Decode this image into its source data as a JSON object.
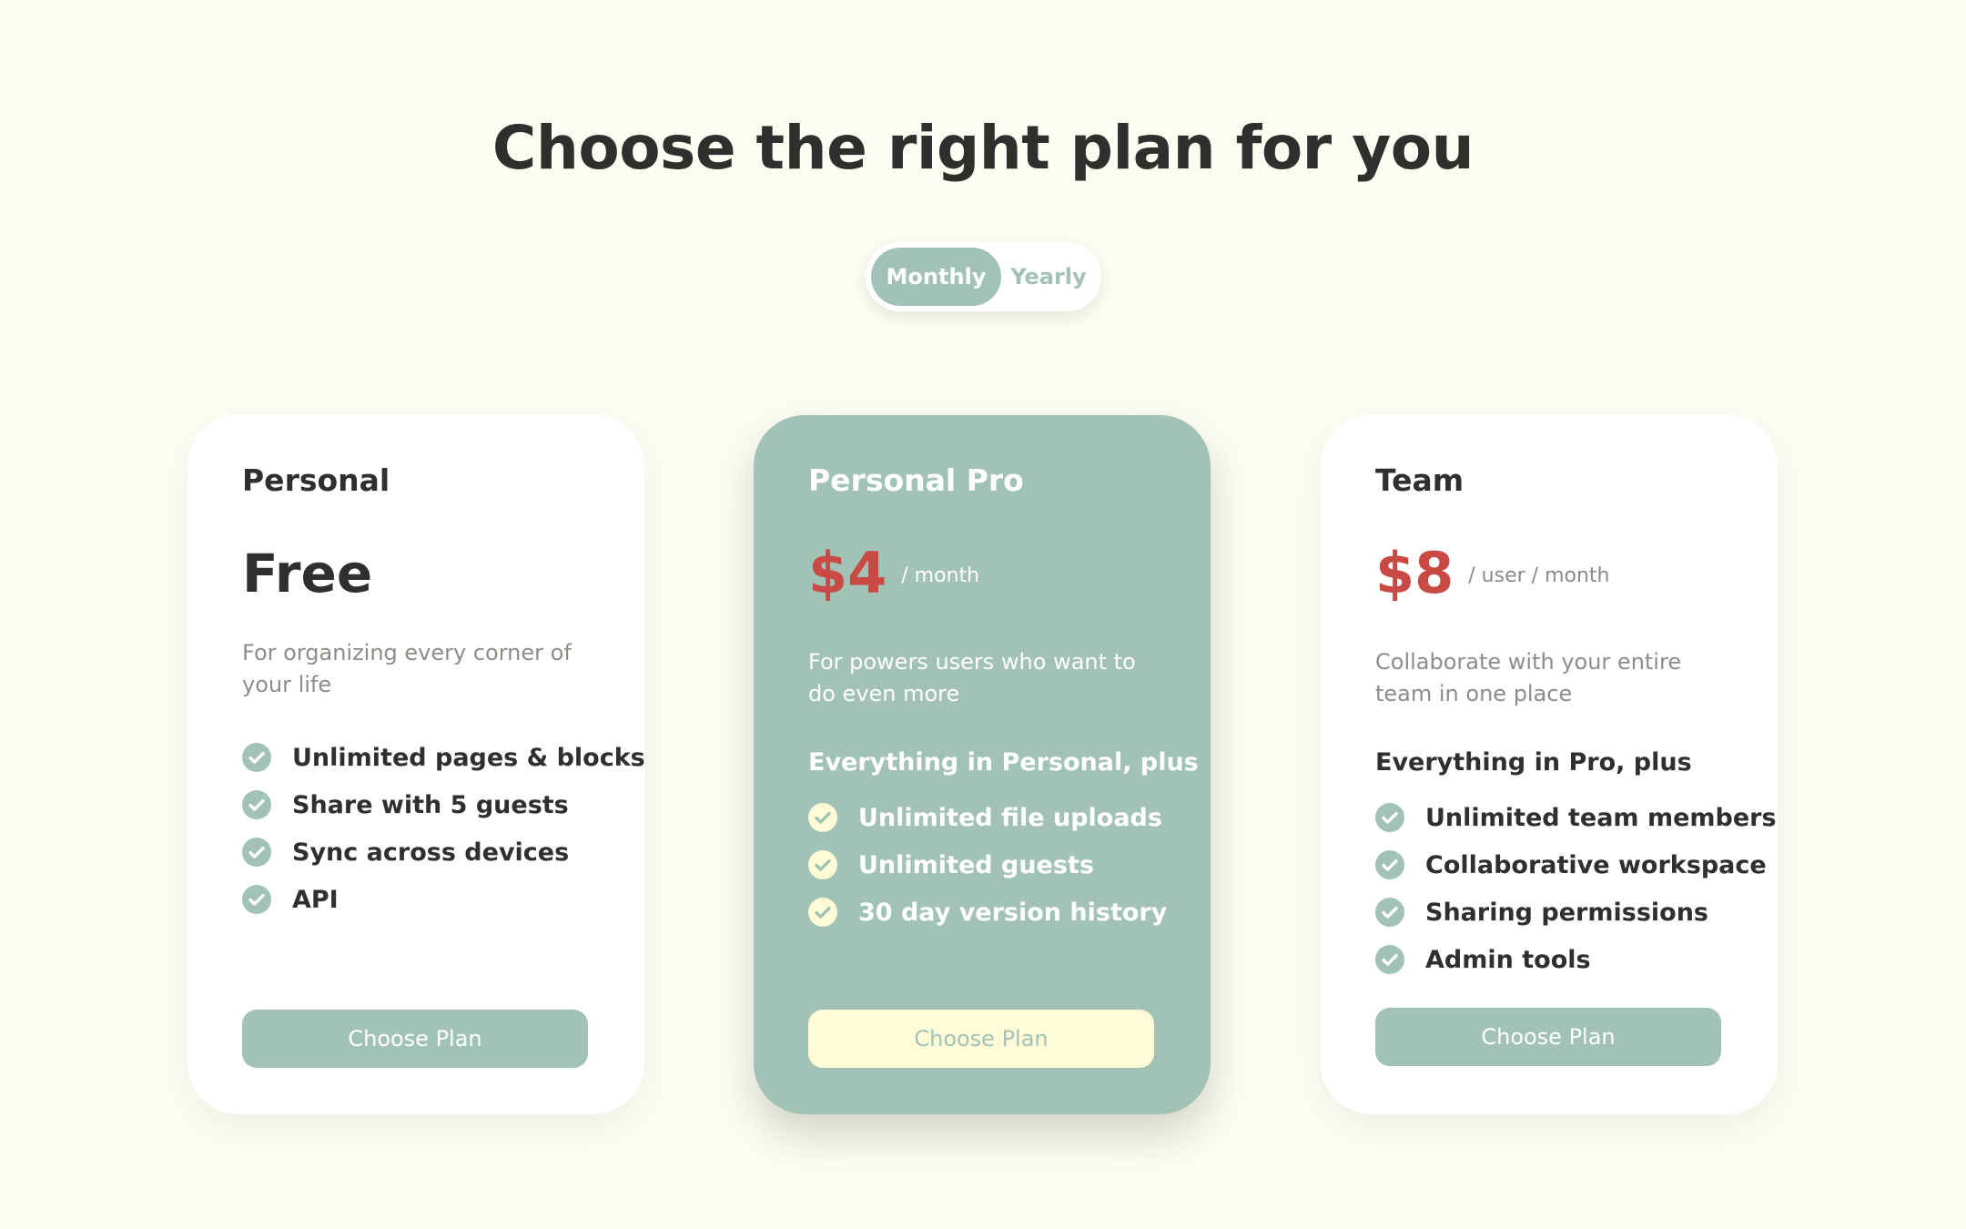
{
  "header": {
    "title": "Choose the right plan for you"
  },
  "billing_toggle": {
    "monthly_label": "Monthly",
    "yearly_label": "Yearly",
    "selected": "Monthly"
  },
  "colors": {
    "background": "#fdfdf4",
    "accent_green": "#a2c2b5",
    "price_red": "#c94a44",
    "button_cream": "#fefbd6"
  },
  "plans": [
    {
      "name": "Personal",
      "price": "Free",
      "price_unit": "",
      "description": "For organizing every corner of your life",
      "features_heading": "",
      "features": [
        "Unlimited pages & blocks",
        "Share with 5 guests",
        "Sync across devices",
        "API"
      ],
      "button_label": "Choose Plan",
      "feature_icon": "check-circle-icon"
    },
    {
      "name": "Personal Pro",
      "price": "$4",
      "price_unit": "/ month",
      "description": "For powers users who want to do even more",
      "features_heading": "Everything in Personal, plus",
      "features": [
        "Unlimited file uploads",
        "Unlimited guests",
        "30 day version history"
      ],
      "button_label": "Choose Plan",
      "feature_icon": "check-circle-icon",
      "highlighted": true
    },
    {
      "name": "Team",
      "price": "$8",
      "price_unit": "/ user / month",
      "description": "Collaborate with your entire team in one place",
      "features_heading": "Everything in Pro, plus",
      "features": [
        "Unlimited team members",
        "Collaborative workspace",
        "Sharing permissions",
        "Admin tools"
      ],
      "button_label": "Choose Plan",
      "feature_icon": "check-circle-icon"
    }
  ]
}
